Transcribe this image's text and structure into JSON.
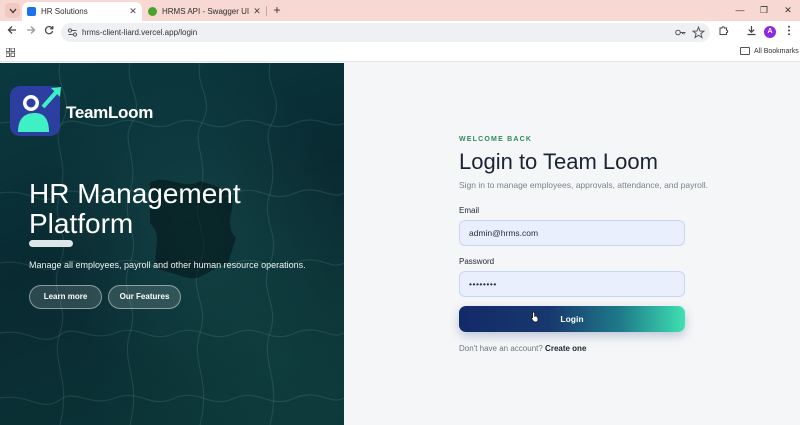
{
  "browser": {
    "tabs": [
      {
        "title": "HR Solutions",
        "active": true
      },
      {
        "title": "HRMS API - Swagger UI",
        "active": false
      }
    ],
    "url": "hrms-client-liard.vercel.app/login",
    "bookmarks_label": "All Bookmarks",
    "profile_initial": "A",
    "colors": {
      "tabbar": "#f7d8d2",
      "profile": "#8a2be2"
    }
  },
  "hero": {
    "brand": "TeamLoom",
    "title_line1": "HR Management",
    "title_line2": "Platform",
    "description": "Manage all employees, payroll and other human resource operations.",
    "buttons": {
      "learn_more": "Learn more",
      "features": "Our Features"
    }
  },
  "login": {
    "eyebrow": "WELCOME BACK",
    "title": "Login to Team Loom",
    "subtitle": "Sign in to manage employees, approvals, attendance, and payroll.",
    "email_label": "Email",
    "email_value": "admin@hrms.com",
    "password_label": "Password",
    "password_value": "••••••••",
    "submit_label": "Login",
    "signup_prompt": "Don't have an account?",
    "signup_link": "Create one",
    "colors": {
      "accent": "#2e8b57",
      "button_start": "#132a68",
      "button_end": "#3fe0b3"
    }
  }
}
